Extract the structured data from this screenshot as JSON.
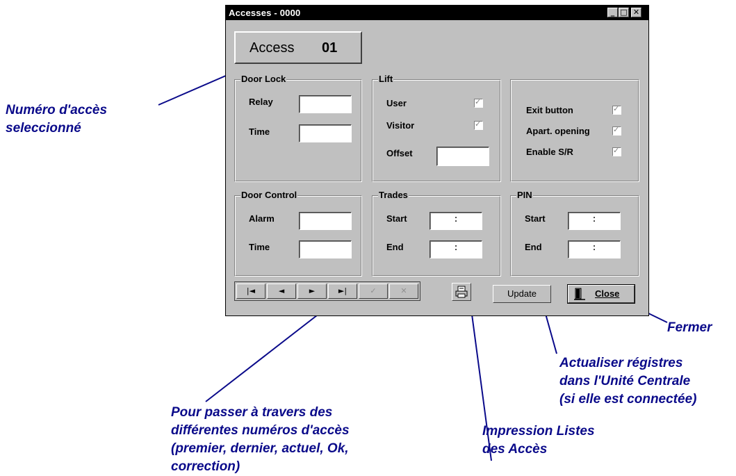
{
  "window": {
    "title": "Accesses - 0000",
    "controls": {
      "minimize": "_",
      "maximize": "□",
      "close": "✕"
    }
  },
  "access": {
    "label": "Access",
    "number": "01"
  },
  "door_lock": {
    "title": "Door Lock",
    "relay_label": "Relay",
    "relay_value": "",
    "time_label": "Time",
    "time_value": ""
  },
  "lift": {
    "title": "Lift",
    "user_label": "User",
    "user_checked": true,
    "visitor_label": "Visitor",
    "visitor_checked": true,
    "offset_label": "Offset",
    "offset_value": ""
  },
  "options": {
    "exit_label": "Exit button",
    "exit_checked": true,
    "apart_label": "Apart. opening",
    "apart_checked": true,
    "enable_label": "Enable S/R",
    "enable_checked": true
  },
  "door_control": {
    "title": "Door Control",
    "alarm_label": "Alarm",
    "alarm_value": "",
    "time_label": "Time",
    "time_value": ""
  },
  "trades": {
    "title": "Trades",
    "start_label": "Start",
    "start_value": ":",
    "end_label": "End",
    "end_value": ":"
  },
  "pin": {
    "title": "PIN",
    "start_label": "Start",
    "start_value": ":",
    "end_label": "End",
    "end_value": ":"
  },
  "nav": {
    "first": "|◄",
    "prev": "◄",
    "next": "►",
    "last": "►|",
    "ok": "✓",
    "cancel": "✕"
  },
  "buttons": {
    "print_icon": "printer-icon",
    "update": "Update",
    "close": "Close",
    "close_icon": "door-icon"
  },
  "annotations": {
    "access_number": [
      "Numéro d'accès",
      "seleccionné"
    ],
    "navigation": [
      "Pour passer à travers des",
      "différentes numéros d'accès",
      "(premier, dernier, actuel, Ok,",
      "correction)"
    ],
    "print": [
      "Impression  Listes",
      "des  Accès"
    ],
    "update": [
      "Actualiser  régistres",
      "dans l'Unité Centrale",
      "(si elle est connectée)"
    ],
    "close": [
      "Fermer"
    ]
  },
  "colors": {
    "annotation": "#0a0a8a",
    "window_bg": "#c0c0c0",
    "titlebar": "#000000"
  }
}
